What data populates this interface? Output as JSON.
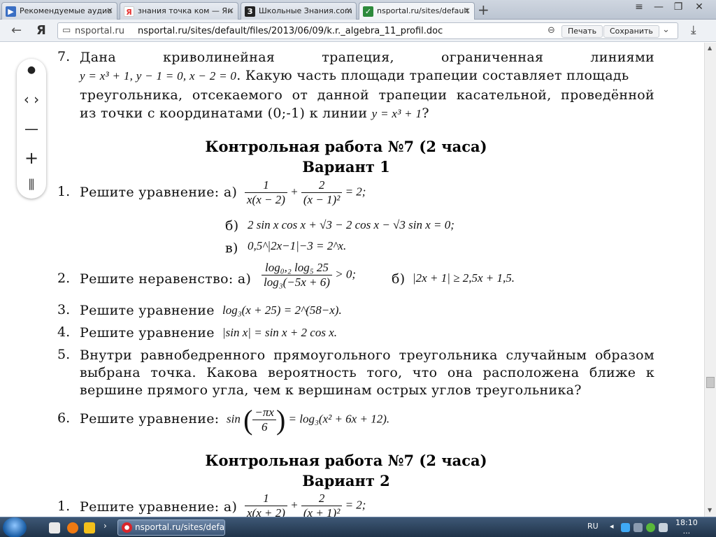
{
  "browser": {
    "tabs": [
      {
        "label": "Рекомендуемые аудио",
        "icon": "audio-icon",
        "color": "#3a6fc4"
      },
      {
        "label": "знания точка ком — Ян",
        "icon": "yandex-icon",
        "color": "#e6312f"
      },
      {
        "label": "Школьные Знания.com",
        "icon": "znanija-icon",
        "color": "#222222"
      },
      {
        "label": "nsportal.ru/sites/default",
        "icon": "checkmark-icon",
        "color": "#2d8a3c"
      }
    ],
    "new_tab": "+",
    "back": "←",
    "yandex_logo": "Я",
    "address_host": "nsportal.ru",
    "address_url": "nsportal.ru/sites/default/files/2013/06/09/k.r._algebra_11_profil.doc",
    "print_label": "Печать",
    "save_label": "Сохранить",
    "window_controls": [
      "≡",
      "—",
      "❐",
      "✕"
    ]
  },
  "side_panel": {
    "dot": "●",
    "arrows": "‹ ›",
    "minus": "—",
    "plus": "+",
    "fit": "⫼"
  },
  "doc": {
    "p7": {
      "number": "7.",
      "line1": "Дана криволинейная трапеция, ограниченная линиями",
      "line2_math": "y = x³ + 1, y − 1 = 0, x − 2 = 0",
      "line2_text": ". Какую часть площади трапеции составляет площадь",
      "line3": "треугольника, отсекаемого от данной трапеции касательной, проведённой",
      "line4_text": "из точки с координатами (0;-1) к линии",
      "line4_math": "y = x³ + 1",
      "line4_end": "?"
    },
    "heading1": "Контрольная работа №7 (2 часа)",
    "variant1": "Вариант 1",
    "t1": {
      "number": "1.",
      "prefix": "Решите уравнение: а)",
      "a_num1": "1",
      "a_den1": "x(x − 2)",
      "a_plus": "+",
      "a_num2": "2",
      "a_den2": "(x − 1)²",
      "a_rhs": "= 2;",
      "b_label": "б)",
      "b_math": "2 sin x cos x + √3 − 2 cos x − √3 sin x = 0;",
      "c_label": "в)",
      "c_math": "0,5^|2x−1|−3 = 2^x."
    },
    "t2": {
      "number": "2.",
      "prefix": "Решите неравенство: а)",
      "num": "log₀,₂ log₅ 25",
      "den": "log₃(−5x + 6)",
      "rhs": "> 0;",
      "b_label": "б)",
      "b_math": "|2x + 1| ≥ 2,5x + 1,5."
    },
    "t3": {
      "number": "3.",
      "prefix": "Решите уравнение",
      "math": "log₃(x + 25) = 2^(58−x)."
    },
    "t4": {
      "number": "4.",
      "prefix": "Решите уравнение",
      "math": "|sin x| = sin x + 2 cos x."
    },
    "t5": {
      "number": "5.",
      "line1": "Внутри равнобедренного прямоугольного треугольника случайным образом",
      "line2": "выбрана точка. Какова вероятность того, что она расположена ближе к",
      "line3": "вершине прямого угла, чем к вершинам острых углов треугольника?"
    },
    "t6": {
      "number": "6.",
      "prefix": "Решите уравнение:",
      "sin": "sin",
      "num": "−πx",
      "den": "6",
      "rhs": "= log₃(x² + 6x + 12)."
    },
    "heading2": "Контрольная работа №7 (2 часа)",
    "variant2": "Вариант 2",
    "v2t1": {
      "number": "1.",
      "prefix": "Решите уравнение: а)",
      "num1": "1",
      "den1": "x(x + 2)",
      "plus": "+",
      "num2": "2",
      "den2": "(x + 1)²",
      "rhs": "= 2;"
    }
  },
  "taskbar": {
    "active_window": "nsportal.ru/sites/defa...",
    "lang": "RU",
    "time": "18:10",
    "date": "..."
  }
}
